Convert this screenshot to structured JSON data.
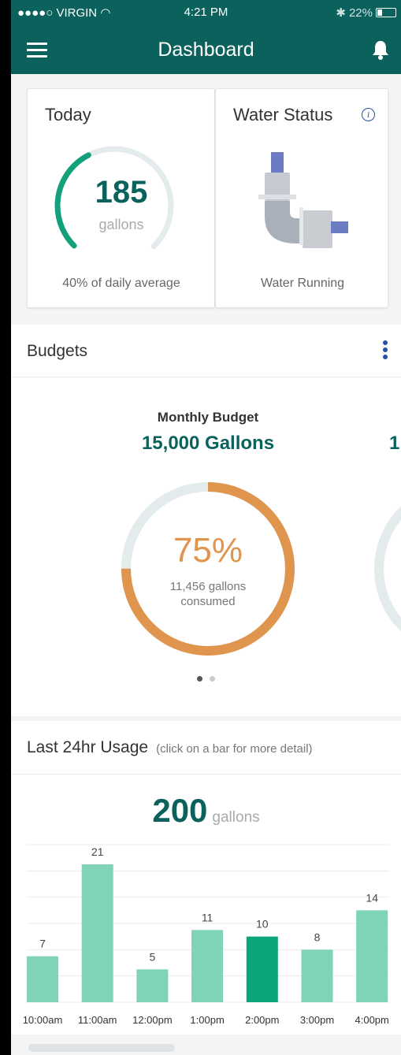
{
  "status_bar": {
    "carrier": "●●●●○ VIRGIN",
    "time": "4:21 PM",
    "battery": "22%"
  },
  "nav": {
    "title": "Dashboard"
  },
  "today_card": {
    "title": "Today",
    "value": "185",
    "unit": "gallons",
    "footer": "40% of daily average",
    "gauge_fraction": 0.4,
    "accent": "#13a07a"
  },
  "water_status_card": {
    "title": "Water Status",
    "info_icon": "info-icon",
    "status": "Water Running"
  },
  "budgets": {
    "title": "Budgets",
    "label": "Monthly Budget",
    "value": "15,000 Gallons",
    "next_peek": "1",
    "percent_text": "75%",
    "percent": 0.75,
    "consumed_line1": "11,456 gallons",
    "consumed_line2": "consumed",
    "ring_color": "#e0954e",
    "track_color": "#e3ebec",
    "page_count": 2,
    "active_page": 0
  },
  "usage": {
    "title": "Last 24hr Usage",
    "hint": "(click on a bar for more detail)",
    "total": "200",
    "total_unit": "gallons"
  },
  "chart_data": {
    "type": "bar",
    "categories": [
      "10:00am",
      "11:00am",
      "12:00pm",
      "1:00pm",
      "2:00pm",
      "3:00pm",
      "4:00pm"
    ],
    "values": [
      7,
      21,
      5,
      11,
      10,
      8,
      14
    ],
    "selected_index": 4,
    "ylim": [
      0,
      24
    ],
    "grid": true,
    "bar_color": "#7fd3b8",
    "selected_color": "#0aa57a"
  }
}
